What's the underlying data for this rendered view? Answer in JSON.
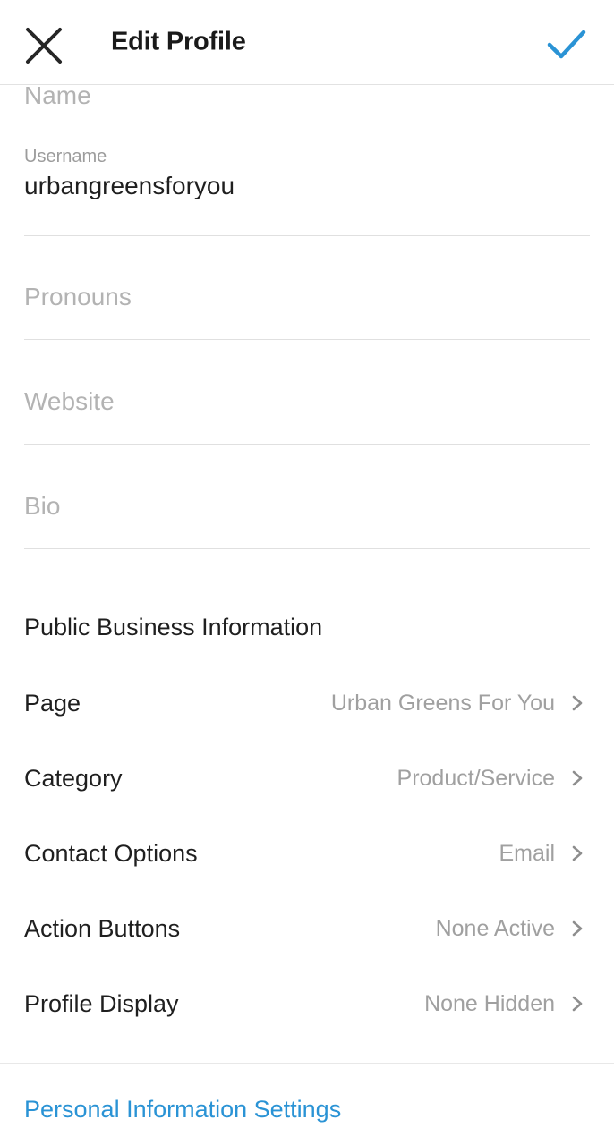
{
  "header": {
    "title": "Edit Profile",
    "close_icon": "close-x-icon",
    "confirm_icon": "checkmark-icon",
    "confirm_color": "#2a93d5"
  },
  "form": {
    "fields": [
      {
        "key": "name",
        "label": "Name",
        "placeholder": "Name",
        "value": ""
      },
      {
        "key": "username",
        "label": "Username",
        "placeholder": "Username",
        "value": "urbangreensforyou"
      },
      {
        "key": "pronouns",
        "label": "Pronouns",
        "placeholder": "Pronouns",
        "value": ""
      },
      {
        "key": "website",
        "label": "Website",
        "placeholder": "Website",
        "value": ""
      },
      {
        "key": "bio",
        "label": "Bio",
        "placeholder": "Bio",
        "value": ""
      }
    ]
  },
  "business": {
    "heading": "Public Business Information",
    "rows": [
      {
        "label": "Page",
        "value": "Urban Greens For You",
        "chevron": "chevron-right-icon"
      },
      {
        "label": "Category",
        "value": "Product/Service",
        "chevron": "chevron-right-icon"
      },
      {
        "label": "Contact Options",
        "value": "Email",
        "chevron": "chevron-right-icon"
      },
      {
        "label": "Action Buttons",
        "value": "None Active",
        "chevron": "chevron-right-icon"
      },
      {
        "label": "Profile Display",
        "value": "None Hidden",
        "chevron": "chevron-right-icon"
      }
    ]
  },
  "footer": {
    "personal_link": "Personal Information Settings",
    "link_color": "#2a93d5"
  }
}
